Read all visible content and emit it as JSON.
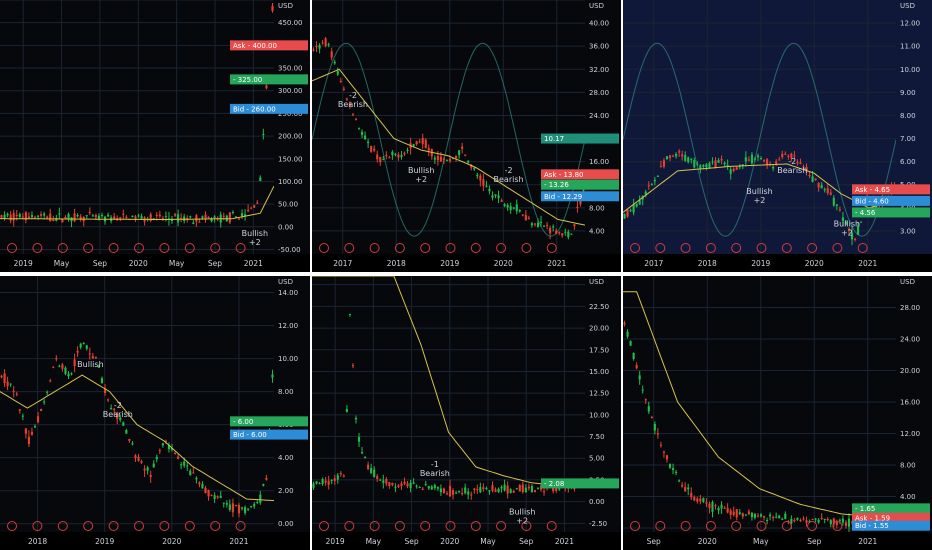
{
  "chart_data": [
    {
      "type": "candlestick",
      "y_unit": "USD",
      "ylim": [
        -60,
        500
      ],
      "y_ticks": [
        "500.00",
        "450.00",
        "400.00",
        "350.00",
        "300.00",
        "250.00",
        "200.00",
        "150.00",
        "100.00",
        "50.00",
        "0.00",
        "-50.00"
      ],
      "x_ticks": [
        "2019",
        "May",
        "Sep",
        "2020",
        "May",
        "Sep",
        "2021"
      ],
      "price_path": [
        [
          0,
          22
        ],
        [
          0.1,
          24
        ],
        [
          0.2,
          20
        ],
        [
          0.3,
          22
        ],
        [
          0.4,
          18
        ],
        [
          0.5,
          21
        ],
        [
          0.6,
          19
        ],
        [
          0.7,
          18
        ],
        [
          0.8,
          17
        ],
        [
          0.9,
          25
        ],
        [
          0.95,
          60
        ],
        [
          0.98,
          330
        ],
        [
          1,
          480
        ]
      ],
      "ma_path": [
        [
          0,
          18
        ],
        [
          0.3,
          17
        ],
        [
          0.6,
          16
        ],
        [
          0.85,
          18
        ],
        [
          0.95,
          30
        ],
        [
          1,
          90
        ]
      ],
      "price_labels": [
        {
          "text": "Ask - 400.00",
          "value": 400,
          "color": "#e74c4c"
        },
        {
          "text": "- 325.00",
          "value": 325,
          "color": "#26a65b"
        },
        {
          "text": "Bid - 260.00",
          "value": 260,
          "color": "#2d8cd6"
        }
      ],
      "annotations": [
        {
          "text": "Bullish",
          "sub": "+2",
          "x": 0.93,
          "y": -20
        }
      ],
      "background": "#06080b"
    },
    {
      "type": "candlestick",
      "y_unit": "USD",
      "ylim": [
        0,
        44
      ],
      "y_ticks": [
        "44.00",
        "40.00",
        "36.00",
        "32.00",
        "28.00",
        "24.00",
        "20.00",
        "16.00",
        "12.00",
        "8.00",
        "4.00"
      ],
      "x_ticks": [
        "2017",
        "2018",
        "2019",
        "2020",
        "2021"
      ],
      "price_path": [
        [
          0,
          35
        ],
        [
          0.05,
          37
        ],
        [
          0.1,
          30
        ],
        [
          0.15,
          24
        ],
        [
          0.2,
          19
        ],
        [
          0.25,
          16
        ],
        [
          0.3,
          17
        ],
        [
          0.35,
          18
        ],
        [
          0.4,
          20
        ],
        [
          0.45,
          17
        ],
        [
          0.5,
          16
        ],
        [
          0.55,
          18
        ],
        [
          0.6,
          14
        ],
        [
          0.65,
          11
        ],
        [
          0.7,
          9
        ],
        [
          0.75,
          8
        ],
        [
          0.8,
          6
        ],
        [
          0.85,
          5
        ],
        [
          0.9,
          4
        ],
        [
          0.95,
          3
        ],
        [
          1,
          11
        ]
      ],
      "ma_path": [
        [
          0,
          30
        ],
        [
          0.1,
          32
        ],
        [
          0.2,
          26
        ],
        [
          0.3,
          20
        ],
        [
          0.4,
          18
        ],
        [
          0.5,
          17
        ],
        [
          0.6,
          15
        ],
        [
          0.7,
          12
        ],
        [
          0.8,
          9
        ],
        [
          0.9,
          6
        ],
        [
          1,
          5
        ]
      ],
      "price_labels": [
        {
          "text": "10.17",
          "value": 20,
          "color": "#1f8f7a"
        },
        {
          "text": "Ask - 13.80",
          "value": 13.8,
          "color": "#e74c4c"
        },
        {
          "text": "- 13.26",
          "value": 12,
          "color": "#26a65b"
        },
        {
          "text": "Bid - 12.29",
          "value": 10,
          "color": "#2d8cd6"
        }
      ],
      "annotations": [
        {
          "text": "-2",
          "sub": "Bearish",
          "x": 0.15,
          "y": 27
        },
        {
          "text": "Bullish",
          "sub": "+2",
          "x": 0.4,
          "y": 14
        },
        {
          "text": "-2",
          "sub": "Bearish",
          "x": 0.72,
          "y": 14
        }
      ],
      "background": "#06080b"
    },
    {
      "type": "candlestick",
      "y_unit": "USD",
      "ylim": [
        2,
        13
      ],
      "y_ticks": [
        "12.00",
        "11.00",
        "10.00",
        "9.00",
        "8.00",
        "7.00",
        "6.00",
        "5.00",
        "4.00",
        "3.00"
      ],
      "x_ticks": [
        "2017",
        "2018",
        "2019",
        "2020",
        "2021"
      ],
      "price_path": [
        [
          0,
          3.6
        ],
        [
          0.05,
          4.2
        ],
        [
          0.1,
          5
        ],
        [
          0.15,
          6
        ],
        [
          0.2,
          6.3
        ],
        [
          0.25,
          6
        ],
        [
          0.3,
          5.8
        ],
        [
          0.35,
          6
        ],
        [
          0.4,
          5.6
        ],
        [
          0.45,
          6
        ],
        [
          0.5,
          6.2
        ],
        [
          0.55,
          5.8
        ],
        [
          0.6,
          6.4
        ],
        [
          0.65,
          5.9
        ],
        [
          0.7,
          5.2
        ],
        [
          0.75,
          4.8
        ],
        [
          0.8,
          3.8
        ],
        [
          0.85,
          2.6
        ],
        [
          0.88,
          3.5
        ],
        [
          0.9,
          4.5
        ],
        [
          0.93,
          4
        ],
        [
          0.96,
          4.3
        ],
        [
          1,
          5
        ]
      ],
      "ma_path": [
        [
          0,
          3.8
        ],
        [
          0.2,
          5.6
        ],
        [
          0.4,
          5.8
        ],
        [
          0.6,
          5.9
        ],
        [
          0.7,
          5.5
        ],
        [
          0.8,
          4.6
        ],
        [
          0.9,
          4
        ],
        [
          1,
          4.3
        ]
      ],
      "price_labels": [
        {
          "text": "Ask - 4.65",
          "value": 4.8,
          "color": "#e74c4c"
        },
        {
          "text": "Bid - 4.60",
          "value": 4.3,
          "color": "#2d8cd6"
        },
        {
          "text": "- 4.56",
          "value": 3.8,
          "color": "#26a65b"
        }
      ],
      "annotations": [
        {
          "text": "-2",
          "sub": "Bearish",
          "x": 0.62,
          "y": 5.9
        },
        {
          "text": "Bullish",
          "sub": "+2",
          "x": 0.5,
          "y": 4.6
        },
        {
          "text": "Bullish",
          "sub": "+2",
          "x": 0.82,
          "y": 3.2
        }
      ],
      "background": "#10183a"
    },
    {
      "type": "candlestick",
      "y_unit": "USD",
      "ylim": [
        -0.5,
        15
      ],
      "y_ticks": [
        "14.00",
        "12.00",
        "10.00",
        "8.00",
        "6.00",
        "4.00",
        "2.00",
        "0.00"
      ],
      "x_ticks": [
        "2018",
        "2019",
        "2020",
        "2021"
      ],
      "price_path": [
        [
          0,
          9
        ],
        [
          0.05,
          8
        ],
        [
          0.1,
          5
        ],
        [
          0.15,
          7
        ],
        [
          0.2,
          10
        ],
        [
          0.25,
          9
        ],
        [
          0.3,
          11
        ],
        [
          0.35,
          10
        ],
        [
          0.4,
          7
        ],
        [
          0.45,
          6
        ],
        [
          0.5,
          4
        ],
        [
          0.55,
          3
        ],
        [
          0.6,
          5
        ],
        [
          0.65,
          4
        ],
        [
          0.7,
          3
        ],
        [
          0.75,
          2
        ],
        [
          0.8,
          1.5
        ],
        [
          0.85,
          1
        ],
        [
          0.9,
          0.8
        ],
        [
          0.95,
          1.2
        ],
        [
          0.98,
          3
        ],
        [
          1,
          9
        ]
      ],
      "ma_path": [
        [
          0,
          8
        ],
        [
          0.1,
          7
        ],
        [
          0.2,
          8
        ],
        [
          0.3,
          9
        ],
        [
          0.4,
          8
        ],
        [
          0.5,
          6
        ],
        [
          0.6,
          5
        ],
        [
          0.7,
          3.5
        ],
        [
          0.8,
          2.5
        ],
        [
          0.9,
          1.5
        ],
        [
          1,
          1.4
        ]
      ],
      "price_labels": [
        {
          "text": "- 6.00",
          "value": 6.2,
          "color": "#26a65b"
        },
        {
          "text": "Bid - 6.00",
          "value": 5.4,
          "color": "#2d8cd6"
        }
      ],
      "annotations": [
        {
          "text": "Bullish",
          "sub": "",
          "x": 0.33,
          "y": 9.5
        },
        {
          "text": "-2",
          "sub": "Bearish",
          "x": 0.43,
          "y": 7
        }
      ],
      "background": "#06080b"
    },
    {
      "type": "candlestick",
      "y_unit": "USD",
      "ylim": [
        -3.5,
        26
      ],
      "y_ticks": [
        "25.00",
        "22.50",
        "20.00",
        "17.50",
        "15.00",
        "12.50",
        "10.00",
        "7.50",
        "5.00",
        "2.50",
        "0.00",
        "-2.50"
      ],
      "x_ticks": [
        "2019",
        "May",
        "Sep",
        "2020",
        "May",
        "Sep",
        "2021"
      ],
      "price_path": [
        [
          0,
          2
        ],
        [
          0.12,
          3
        ],
        [
          0.13,
          24
        ],
        [
          0.16,
          8
        ],
        [
          0.2,
          4
        ],
        [
          0.25,
          2.5
        ],
        [
          0.3,
          1.8
        ],
        [
          0.4,
          2
        ],
        [
          0.5,
          1.2
        ],
        [
          0.6,
          1.4
        ],
        [
          0.7,
          1.3
        ],
        [
          0.8,
          1.5
        ],
        [
          0.9,
          1.6
        ],
        [
          0.95,
          1.8
        ],
        [
          1,
          2.1
        ]
      ],
      "ma_path": [
        [
          0.3,
          26
        ],
        [
          0.4,
          18
        ],
        [
          0.5,
          8
        ],
        [
          0.6,
          4
        ],
        [
          0.7,
          3
        ],
        [
          0.8,
          2.2
        ],
        [
          0.9,
          1.8
        ],
        [
          1,
          1.7
        ]
      ],
      "price_labels": [
        {
          "text": "- 2.08",
          "value": 2.1,
          "color": "#26a65b"
        }
      ],
      "annotations": [
        {
          "text": "-1",
          "sub": "Bearish",
          "x": 0.45,
          "y": 4
        },
        {
          "text": "Bullish",
          "sub": "+2",
          "x": 0.77,
          "y": -1.5
        }
      ],
      "background": "#06080b"
    },
    {
      "type": "candlestick",
      "y_unit": "USD",
      "ylim": [
        -0.5,
        32
      ],
      "y_ticks": [
        "28.00",
        "24.00",
        "20.00",
        "16.00",
        "12.00",
        "8.00",
        "4.00",
        "0.00"
      ],
      "x_ticks": [
        "Sep",
        "2020",
        "May",
        "Sep",
        "2021"
      ],
      "price_path": [
        [
          0,
          26
        ],
        [
          0.05,
          20
        ],
        [
          0.1,
          14
        ],
        [
          0.15,
          9
        ],
        [
          0.2,
          6
        ],
        [
          0.25,
          4
        ],
        [
          0.3,
          3
        ],
        [
          0.4,
          2
        ],
        [
          0.5,
          1.5
        ],
        [
          0.6,
          1.2
        ],
        [
          0.7,
          1
        ],
        [
          0.8,
          0.8
        ],
        [
          0.9,
          1
        ],
        [
          0.95,
          1.4
        ],
        [
          1,
          2
        ]
      ],
      "ma_path": [
        [
          0.05,
          30
        ],
        [
          0.2,
          16
        ],
        [
          0.35,
          9
        ],
        [
          0.5,
          5
        ],
        [
          0.65,
          3
        ],
        [
          0.8,
          1.8
        ],
        [
          0.9,
          1.5
        ],
        [
          1,
          1.4
        ]
      ],
      "price_labels": [
        {
          "text": "- 1.65",
          "value": 2.5,
          "color": "#26a65b"
        },
        {
          "text": "Ask - 1.59",
          "value": 1.3,
          "color": "#e74c4c"
        },
        {
          "text": "Bid - 1.55",
          "value": 0.3,
          "color": "#2d8cd6"
        }
      ],
      "annotations": [],
      "background": "#06080b"
    }
  ]
}
